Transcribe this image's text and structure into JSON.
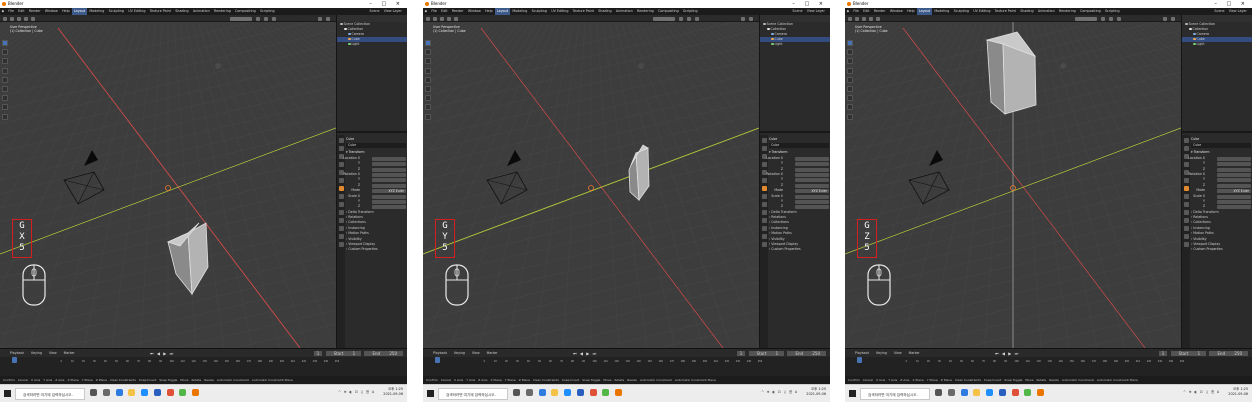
{
  "app": {
    "window_title": "Blender",
    "window_controls": [
      "–",
      "□",
      "×"
    ]
  },
  "menu": {
    "items": [
      "File",
      "Edit",
      "Render",
      "Window",
      "Help"
    ],
    "workspaces": [
      "Layout",
      "Modeling",
      "Sculpting",
      "UV Editing",
      "Texture Paint",
      "Shading",
      "Animation",
      "Rendering",
      "Compositing",
      "Scripting"
    ],
    "active_workspace": "Layout",
    "scene_label": "Scene",
    "view_layer_label": "View Layer"
  },
  "viewport": {
    "view_name": "User Perspective",
    "collection_path": "(1) Collection | Cube"
  },
  "outliner": {
    "title": "Scene Collection",
    "rows": [
      {
        "label": "Scene Collection",
        "indent": 0,
        "color": "#b7b7b7"
      },
      {
        "label": "Collection",
        "indent": 1,
        "color": "#e6e6e6"
      },
      {
        "label": "Camera",
        "indent": 2,
        "color": "#7fb0e5"
      },
      {
        "label": "Cube",
        "indent": 2,
        "color": "#f0a74a"
      },
      {
        "label": "Light",
        "indent": 2,
        "color": "#7fd07a"
      }
    ]
  },
  "properties": {
    "object_name": "Cube",
    "section": "Transform",
    "location_label": "Location X",
    "rotation_label": "Rotation X",
    "scale_label": "Scale X",
    "mode_label": "Mode",
    "mode_value": "XYZ Euler",
    "axis_labels": [
      "Y",
      "Z"
    ],
    "collapsed_sections": [
      "Delta Transform",
      "Relations",
      "Collections",
      "Instancing",
      "Motion Paths",
      "Visibility",
      "Viewport Display",
      "Custom Properties"
    ]
  },
  "timeline": {
    "menu": [
      "Playback",
      "Keying",
      "View",
      "Marker"
    ],
    "start_label": "Start",
    "end_label": "End",
    "current_frame": "1",
    "start_frame": "1",
    "end_frame": "250",
    "ruler": [
      "0",
      "10",
      "20",
      "30",
      "40",
      "50",
      "60",
      "70",
      "80",
      "90",
      "100",
      "110",
      "120",
      "130",
      "140",
      "150",
      "160",
      "170",
      "180",
      "190",
      "200",
      "210",
      "220",
      "230",
      "240",
      "250"
    ]
  },
  "statusbar": {
    "items": [
      "Confirm",
      "Cancel",
      "X Axis",
      "Y Axis",
      "Z Axis",
      "X Plane",
      "Y Plane",
      "Z Plane",
      "Clear Constraints",
      "Snap Invert",
      "Snap Toggle",
      "Move",
      "Rotate",
      "Resize",
      "Automatic Constraint",
      "Automatic Constraint Plane"
    ]
  },
  "taskbar": {
    "search_placeholder": "검색하려면 여기에 입력하십시오.",
    "time": "오후 1:25",
    "date": "2021-09-06",
    "tray_icons": "^ ⊕ ◐ ⊡ ♫ 한 A"
  },
  "screenshots": [
    {
      "keys": [
        "G",
        "X",
        "5"
      ],
      "axis_highlight": "x",
      "cube": "moved along X axis (lower right)"
    },
    {
      "keys": [
        "G",
        "Y",
        "5"
      ],
      "axis_highlight": "y",
      "cube": "moved along Y axis"
    },
    {
      "keys": [
        "G",
        "Z",
        "5"
      ],
      "axis_highlight": "z",
      "cube": "moved along Z axis (up)"
    }
  ],
  "colors": {
    "x_axis": "#d44a4a",
    "y_axis": "#b8c83a",
    "z_axis": "#3a6bd4",
    "accent": "#4772b3",
    "key_box": "#d41f1f"
  }
}
